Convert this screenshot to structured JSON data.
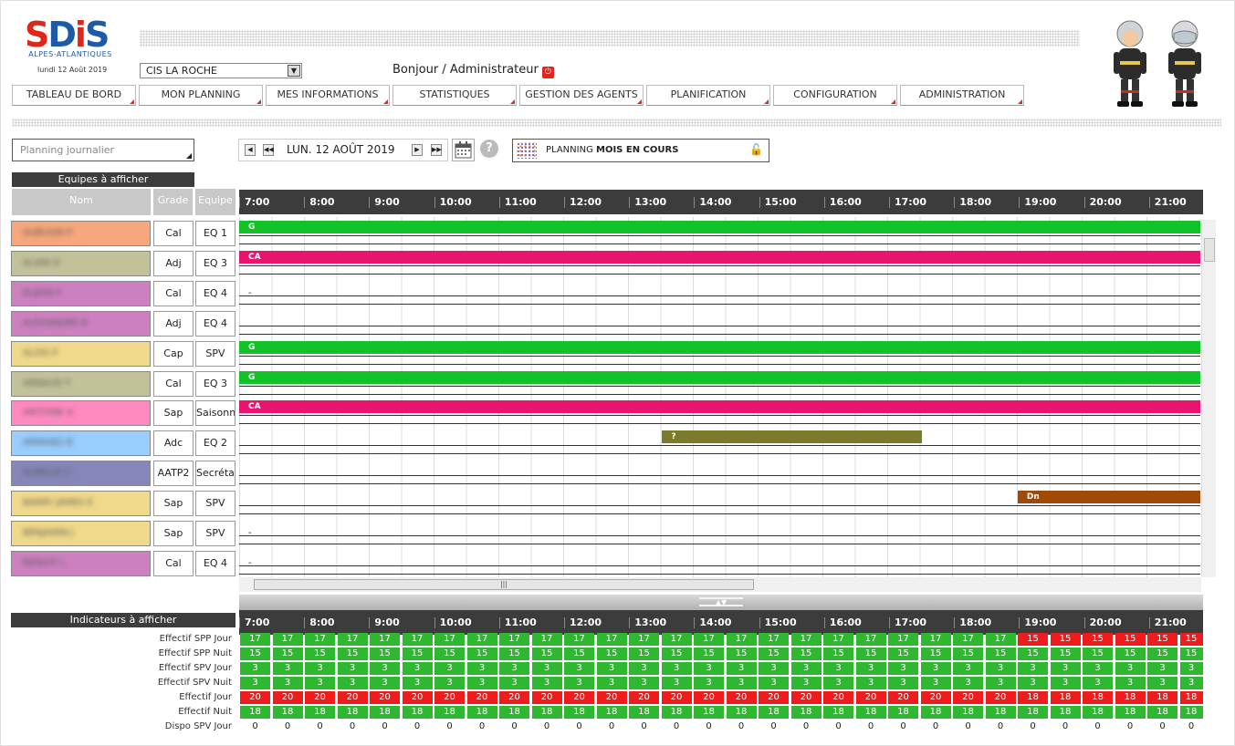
{
  "header": {
    "logo_text": "SDiS",
    "logo_sub": "ALPES-ATLANTIQUES",
    "date_small": "lundi 12 Août 2019",
    "cis_select": "CIS LA ROCHE",
    "greeting": "Bonjour / Administrateur"
  },
  "nav": [
    "TABLEAU DE BORD",
    "MON PLANNING",
    "MES INFORMATIONS",
    "STATISTIQUES",
    "GESTION DES AGENTS",
    "PLANIFICATION",
    "CONFIGURATION",
    "ADMINISTRATION"
  ],
  "toolbar": {
    "view_select": "Planning journalier",
    "date": "LUN. 12 AOÛT 2019",
    "help": "?",
    "planning_prefix": "PLANNING",
    "planning_bold": "MOIS EN COURS"
  },
  "people_section": {
    "title": "Equipes à afficher",
    "col_name": "Nom",
    "col_grade": "Grade",
    "col_equipe": "Equipe"
  },
  "hours": [
    "7:00",
    "8:00",
    "9:00",
    "10:00",
    "11:00",
    "12:00",
    "13:00",
    "14:00",
    "15:00",
    "16:00",
    "17:00",
    "18:00",
    "19:00",
    "20:00",
    "21:00"
  ],
  "rows": [
    {
      "name": "AUBUSIN P",
      "color": "#f7a77b",
      "grade": "Cal",
      "equipe": "EQ 1",
      "bar": {
        "label": "G",
        "color": "#11c228",
        "start": 0,
        "end": 1.0
      }
    },
    {
      "name": "ALAIN D",
      "color": "#c2c29a",
      "grade": "Adj",
      "equipe": "EQ 3",
      "bar": {
        "label": "CA",
        "color": "#e8146e",
        "start": 0,
        "end": 1.0
      }
    },
    {
      "name": "ALBAN F",
      "color": "#cc80c0",
      "grade": "Cal",
      "equipe": "EQ 4",
      "dash": "-"
    },
    {
      "name": "ALEXANDRE B",
      "color": "#cc80c0",
      "grade": "Adj",
      "equipe": "EQ 4"
    },
    {
      "name": "ALOIS P",
      "color": "#f0d98a",
      "grade": "Cap",
      "equipe": "SPV",
      "bar": {
        "label": "G",
        "color": "#11c228",
        "start": 0,
        "end": 1.0
      }
    },
    {
      "name": "ARNAUD T",
      "color": "#c2c29a",
      "grade": "Cal",
      "equipe": "EQ 3",
      "bar": {
        "label": "G",
        "color": "#11c228",
        "start": 0,
        "end": 1.0
      }
    },
    {
      "name": "ANTOINE A",
      "color": "#ff8ac0",
      "grade": "Sap",
      "equipe": "Saisonnier",
      "bar": {
        "label": "CA",
        "color": "#e8146e",
        "start": 0,
        "end": 1.0
      }
    },
    {
      "name": "ARMAND B",
      "color": "#99ccff",
      "grade": "Adc",
      "equipe": "EQ 2",
      "bar": {
        "label": "?",
        "color": "#7b7b2c",
        "start": 0.44,
        "end": 0.71
      }
    },
    {
      "name": "AURELIE C",
      "color": "#8686ba",
      "grade": "AATP2",
      "equipe": "Secrétariat"
    },
    {
      "name": "BARRY JAMES E",
      "color": "#f0d98a",
      "grade": "Sap",
      "equipe": "SPV",
      "bar": {
        "label": "Dn",
        "color": "#a04a08",
        "start": 0.81,
        "end": 1.0
      }
    },
    {
      "name": "BENJAMIN J",
      "color": "#f0d98a",
      "grade": "Sap",
      "equipe": "SPV",
      "dash": "-"
    },
    {
      "name": "BENOIT L",
      "color": "#cc80c0",
      "grade": "Cal",
      "equipe": "EQ 4",
      "dash": "-"
    }
  ],
  "indicators": {
    "title": "Indicateurs à afficher",
    "rows": [
      {
        "label": "Effectif SPP Jour",
        "values": [
          17,
          17,
          17,
          17,
          17,
          17,
          17,
          17,
          17,
          17,
          17,
          17,
          17,
          17,
          17,
          17,
          17,
          17,
          17,
          17,
          17,
          17,
          17,
          17,
          15,
          15,
          15,
          15,
          15,
          15
        ],
        "red_from": 24
      },
      {
        "label": "Effectif SPP Nuit",
        "values": [
          15,
          15,
          15,
          15,
          15,
          15,
          15,
          15,
          15,
          15,
          15,
          15,
          15,
          15,
          15,
          15,
          15,
          15,
          15,
          15,
          15,
          15,
          15,
          15,
          15,
          15,
          15,
          15,
          15,
          15
        ]
      },
      {
        "label": "Effectif SPV Jour",
        "values": [
          3,
          3,
          3,
          3,
          3,
          3,
          3,
          3,
          3,
          3,
          3,
          3,
          3,
          3,
          3,
          3,
          3,
          3,
          3,
          3,
          3,
          3,
          3,
          3,
          3,
          3,
          3,
          3,
          3,
          3
        ]
      },
      {
        "label": "Effectif SPV Nuit",
        "values": [
          3,
          3,
          3,
          3,
          3,
          3,
          3,
          3,
          3,
          3,
          3,
          3,
          3,
          3,
          3,
          3,
          3,
          3,
          3,
          3,
          3,
          3,
          3,
          3,
          3,
          3,
          3,
          3,
          3,
          3
        ]
      },
      {
        "label": "Effectif Jour",
        "values": [
          20,
          20,
          20,
          20,
          20,
          20,
          20,
          20,
          20,
          20,
          20,
          20,
          20,
          20,
          20,
          20,
          20,
          20,
          20,
          20,
          20,
          20,
          20,
          20,
          18,
          18,
          18,
          18,
          18,
          18
        ],
        "red_all": true
      },
      {
        "label": "Effectif Nuit",
        "values": [
          18,
          18,
          18,
          18,
          18,
          18,
          18,
          18,
          18,
          18,
          18,
          18,
          18,
          18,
          18,
          18,
          18,
          18,
          18,
          18,
          18,
          18,
          18,
          18,
          18,
          18,
          18,
          18,
          18,
          18
        ]
      },
      {
        "label": "Dispo SPV Jour",
        "values": [
          0,
          0,
          0,
          0,
          0,
          0,
          0,
          0,
          0,
          0,
          0,
          0,
          0,
          0,
          0,
          0,
          0,
          0,
          0,
          0,
          0,
          0,
          0,
          0,
          0,
          0,
          0,
          0,
          0,
          0
        ],
        "plain": true
      }
    ]
  },
  "colors": {
    "green": "#2db82f",
    "red": "#ee1c1c",
    "dark": "#3c3c3c"
  }
}
